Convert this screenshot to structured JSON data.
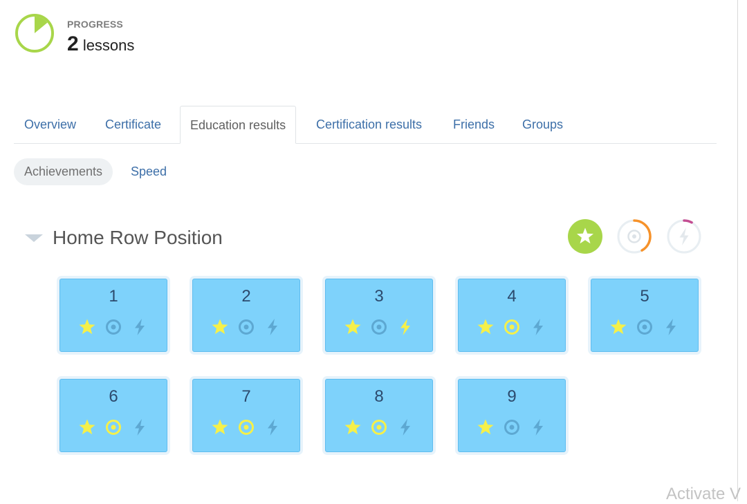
{
  "progress": {
    "label": "PROGRESS",
    "count": "2",
    "unit": "lessons",
    "ring_fill_fraction": 0.14
  },
  "tabs": [
    {
      "label": "Overview",
      "active": false
    },
    {
      "label": "Certificate",
      "active": false
    },
    {
      "label": "Education results",
      "active": true
    },
    {
      "label": "Certification results",
      "active": false
    },
    {
      "label": "Friends",
      "active": false
    },
    {
      "label": "Groups",
      "active": false
    }
  ],
  "subtabs": [
    {
      "label": "Achievements",
      "active": true
    },
    {
      "label": "Speed",
      "active": false
    }
  ],
  "section": {
    "title": "Home Row Position",
    "legend": [
      {
        "icon": "star-icon",
        "color": "#a8d64a",
        "progress": 1.0
      },
      {
        "icon": "target-icon",
        "color": "#f6922a",
        "progress": 0.42
      },
      {
        "icon": "lightning-icon",
        "color": "#c34d92",
        "progress": 0.08
      }
    ]
  },
  "lessons": [
    {
      "number": "1",
      "star": true,
      "accuracy": false,
      "speed": false
    },
    {
      "number": "2",
      "star": true,
      "accuracy": false,
      "speed": false
    },
    {
      "number": "3",
      "star": true,
      "accuracy": false,
      "speed": true
    },
    {
      "number": "4",
      "star": true,
      "accuracy": true,
      "speed": false
    },
    {
      "number": "5",
      "star": true,
      "accuracy": false,
      "speed": false
    },
    {
      "number": "6",
      "star": true,
      "accuracy": true,
      "speed": false
    },
    {
      "number": "7",
      "star": true,
      "accuracy": true,
      "speed": false
    },
    {
      "number": "8",
      "star": true,
      "accuracy": true,
      "speed": false
    },
    {
      "number": "9",
      "star": true,
      "accuracy": false,
      "speed": false
    }
  ],
  "colors": {
    "earned": "#f5f04a",
    "unearned": "#5da8d2",
    "progress_ring": "#a8d64a",
    "link": "#3d6fa8"
  },
  "watermark": "Activate V"
}
